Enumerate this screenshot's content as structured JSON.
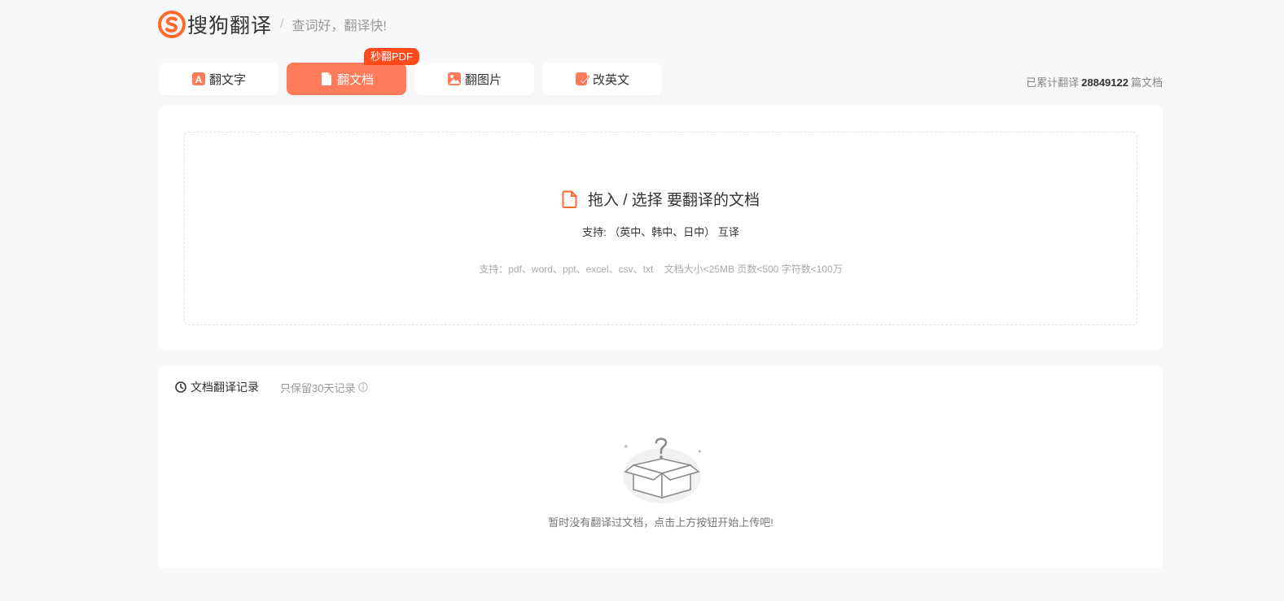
{
  "header": {
    "logo_text": "搜狗翻译",
    "divider": "/",
    "slogan": "查词好，翻译快!"
  },
  "tabs": [
    {
      "label": "翻文字",
      "icon": "text-a-icon",
      "active": false
    },
    {
      "label": "翻文档",
      "icon": "document-icon",
      "active": true,
      "badge": "秒翻PDF"
    },
    {
      "label": "翻图片",
      "icon": "image-icon",
      "active": false
    },
    {
      "label": "改英文",
      "icon": "check-edit-icon",
      "active": false
    }
  ],
  "counter": {
    "prefix": "已累计翻译",
    "count": "28849122",
    "suffix": "篇文档"
  },
  "upload": {
    "title": "拖入 / 选择 要翻译的文档",
    "languages": "支持: （英中、韩中、日中） 互译",
    "formats": "支持：pdf、word、ppt、excel、csv、txt    文档大小<25MB 页数<500 字符数<100万"
  },
  "records": {
    "title": "文档翻译记录",
    "note": "只保留30天记录",
    "empty_text": "暂时没有翻译过文档，点击上方按钮开始上传吧!"
  },
  "colors": {
    "brand": "#ff6a2b",
    "active_tab": "#ff7b5a",
    "badge": "#ff4a1c"
  }
}
